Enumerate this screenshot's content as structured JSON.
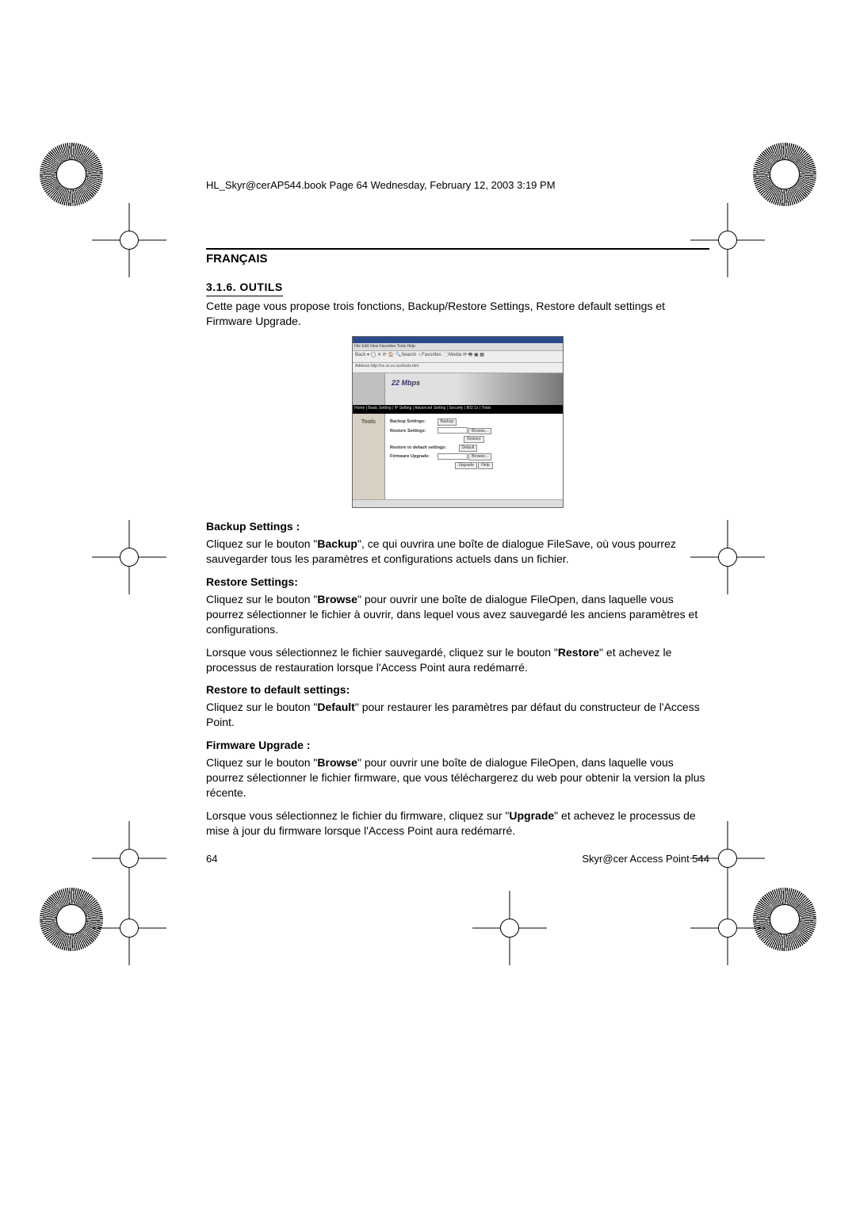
{
  "print_header": "HL_Skyr@cerAP544.book  Page 64  Wednesday, February 12, 2003  3:19 PM",
  "language_label": "FRANÇAIS",
  "section_number_title": "3.1.6. OUTILS",
  "intro_para": "Cette page vous propose trois fonctions, Backup/Restore Settings, Restore default settings et Firmware Upgrade.",
  "screenshot": {
    "menubar": "File  Edit  View  Favorites  Tools  Help",
    "toolbar": "Back ▾  ◯  ✕ ⟳ 🏠  🔍Search ☆Favorites 🕑Media  ✉  🖶  ▣ ▦",
    "addr": "Address  http://xx.xx.xx.xxx/tools.htm",
    "banner_logo": "22 Mbps",
    "tabs": "Home | Basic Setting | IP Setting | Advanced Setting | Security | 802.1x | Tools",
    "side_label": "Tools",
    "rows": {
      "backup": {
        "label": "Backup Settings:",
        "btn": "Backup"
      },
      "restore": {
        "label": "Restore Settings:",
        "btn": "Browse...",
        "btn2": "Restore"
      },
      "default": {
        "label": "Restore to default settings:",
        "btn": "Default"
      },
      "firmware": {
        "label": "Firmware Upgrade:",
        "btn": "Browse...",
        "btn2": "Upgrade",
        "btn3": "Help"
      }
    }
  },
  "backup": {
    "head": "Backup Settings :",
    "body_pre": "Cliquez sur le bouton \"",
    "body_bold": "Backup",
    "body_post": "\", ce qui ouvrira une boîte de dialogue FileSave, où vous pourrez sauvegarder tous les paramètres et configurations actuels dans un fichier."
  },
  "restore": {
    "head": "Restore Settings:",
    "p1_pre": "Cliquez sur le bouton \"",
    "p1_bold": "Browse",
    "p1_post": "\" pour ouvrir une boîte de dialogue FileOpen, dans laquelle vous pourrez sélectionner le fichier à ouvrir, dans lequel vous avez sauvegardé les anciens paramètres et configurations.",
    "p2_pre": "Lorsque vous sélectionnez le fichier sauvegardé, cliquez sur le bouton \"",
    "p2_bold": "Restore",
    "p2_post": "\" et achevez le processus de restauration lorsque l'Access Point aura redémarré."
  },
  "defaults": {
    "head": "Restore to default settings:",
    "pre": "Cliquez sur le bouton \"",
    "bold": "Default",
    "post": "\" pour restaurer les paramètres par défaut du constructeur de l'Access Point."
  },
  "firmware": {
    "head": "Firmware Upgrade :",
    "p1_pre": "Cliquez sur le bouton \"",
    "p1_bold": "Browse",
    "p1_post": "\" pour ouvrir une boîte de dialogue FileOpen, dans laquelle vous pourrez sélectionner le fichier firmware, que vous téléchargerez du web pour obtenir la version la plus récente.",
    "p2_pre": "Lorsque vous sélectionnez le fichier du firmware, cliquez sur \"",
    "p2_bold": "Upgrade",
    "p2_post": "\" et achevez le processus de mise à jour du firmware lorsque l'Access Point aura redémarré."
  },
  "footer": {
    "page": "64",
    "product": "Skyr@cer Access Point 544"
  }
}
